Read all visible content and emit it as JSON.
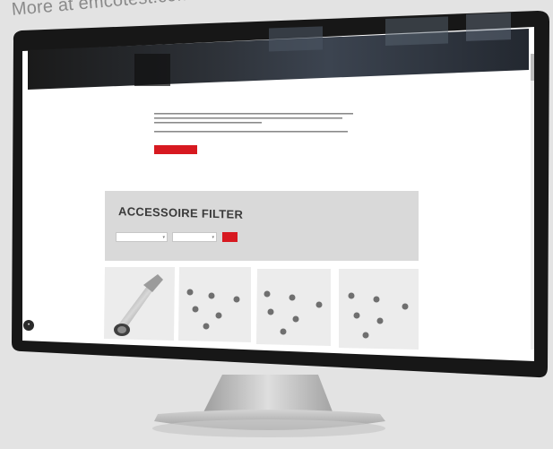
{
  "headline": {
    "text": "More at emcotest.com"
  },
  "page": {
    "intro_button_label": "",
    "filter_title": "ACCESSOIRE FILTER",
    "filter_select_1": "",
    "filter_select_2": "",
    "filter_button_label": "",
    "chat_icon": "chat-icon"
  },
  "colors": {
    "accent_red": "#d71920",
    "panel_gray": "#d9d9d9",
    "bezel": "#171717"
  }
}
